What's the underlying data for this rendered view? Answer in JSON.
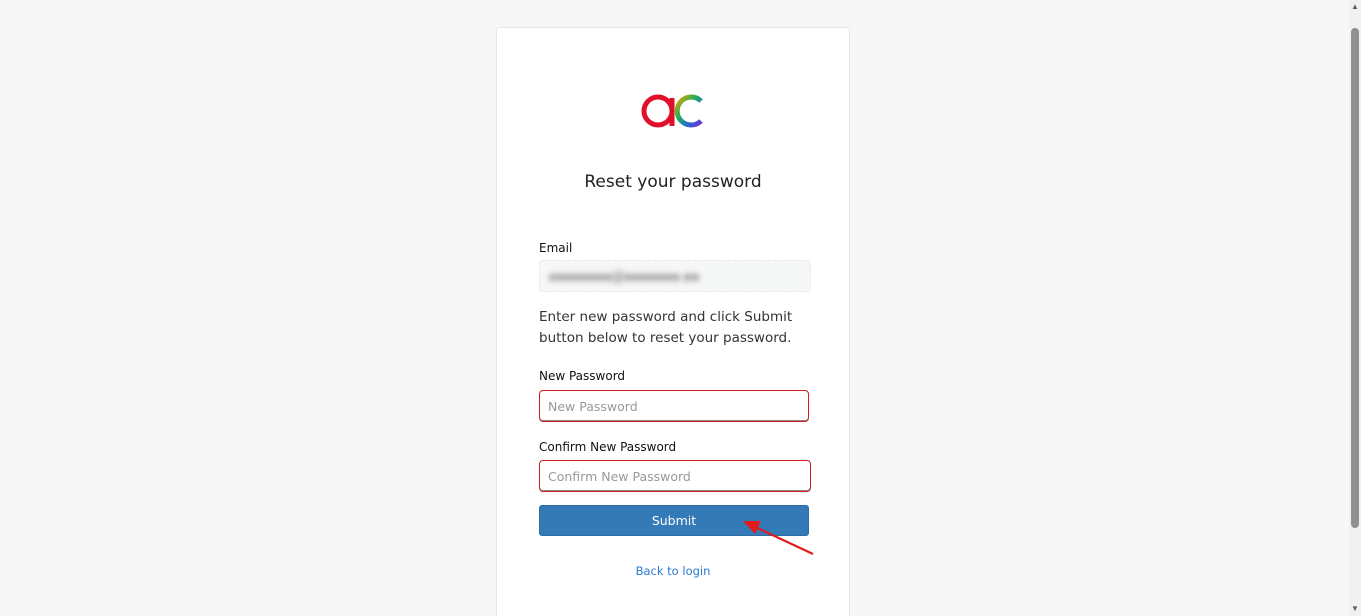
{
  "page": {
    "title": "Reset your password"
  },
  "logo": {
    "icon": "ac-logo",
    "colors": [
      "#e0102a",
      "#f5a000",
      "#2ab34a",
      "#1f6fd6",
      "#7a2bd0"
    ]
  },
  "form": {
    "email_label": "Email",
    "email_value": "●●●●●●●●@●●●●●●●.●●",
    "instructions": "Enter new password and click Submit button below to reset your password.",
    "new_password_label": "New Password",
    "new_password_placeholder": "New Password",
    "confirm_password_label": "Confirm New Password",
    "confirm_password_placeholder": "Confirm New Password",
    "submit_label": "Submit",
    "back_link": "Back to login"
  },
  "annotation": {
    "arrow_color": "#e01b1b",
    "highlight_color": "#d21f1f"
  },
  "colors": {
    "primary_button": "#337ab7",
    "link": "#2a7ad2",
    "background": "#f7f7f7"
  }
}
